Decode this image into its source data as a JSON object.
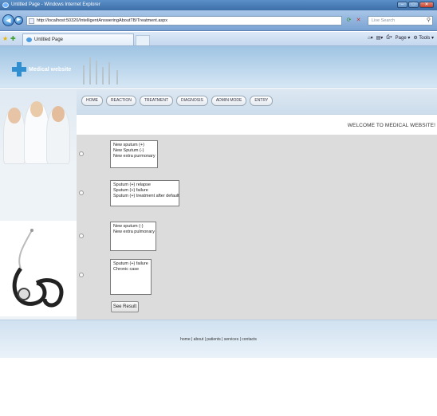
{
  "window": {
    "title": "Untitled Page - Windows Internet Explorer",
    "url": "http://localhost:50320/IntelligentAnsweringAboutTB/Treatment.aspx",
    "search_placeholder": "Live Search"
  },
  "tabs": [
    {
      "label": "Untitled Page"
    }
  ],
  "commandbar": {
    "page": "Page",
    "tools": "Tools"
  },
  "site": {
    "logo": "Medical website"
  },
  "nav": {
    "items": [
      {
        "label": "HOME"
      },
      {
        "label": "REACTION"
      },
      {
        "label": "TREATMENT"
      },
      {
        "label": "DIAGNOSIS"
      },
      {
        "label": "ADMIN MODE"
      },
      {
        "label": "ENTRY"
      }
    ]
  },
  "welcome": "WELCOME TO MEDICAL WEBSITE!",
  "options": [
    {
      "lines": [
        "New sputum (+)",
        "New Sputum (-)",
        "New extra purmonary"
      ]
    },
    {
      "lines": [
        "Sputum (+) relapse",
        "Sputum (+) failure",
        "Sputum (+) treatment after default"
      ]
    },
    {
      "lines": [
        "New sputum (-)",
        "New extra pulmonary"
      ]
    },
    {
      "lines": [
        "Sputum (+) failure",
        "Chronic case"
      ]
    }
  ],
  "button": {
    "see_result": "See Result"
  },
  "footer": {
    "links": "home | about | patients | services | contacts"
  }
}
